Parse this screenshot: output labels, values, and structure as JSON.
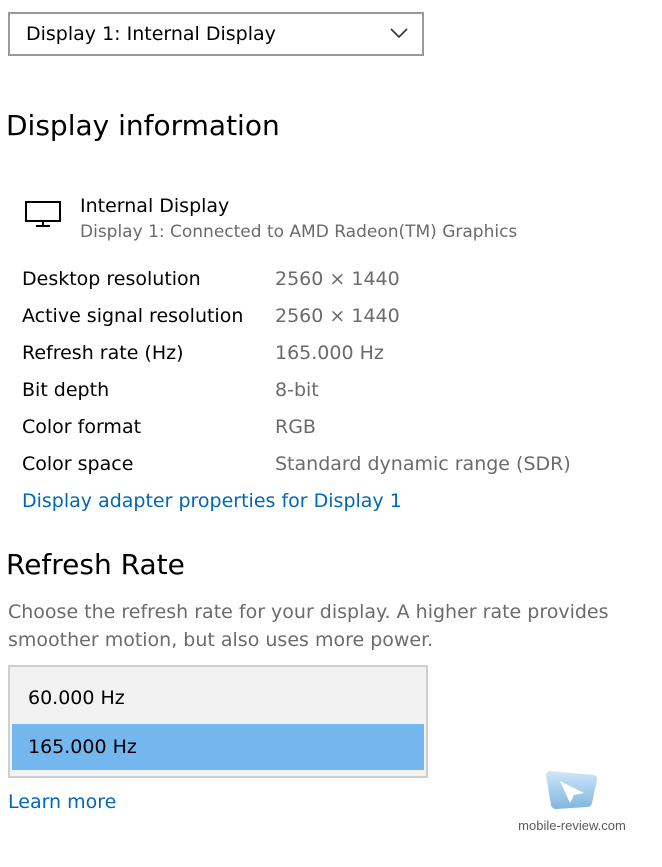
{
  "display_selector": {
    "selected": "Display 1: Internal Display",
    "icon": "chevron-down-icon"
  },
  "display_information": {
    "heading": "Display information",
    "monitor_icon": "monitor-icon",
    "name": "Internal Display",
    "connection": "Display 1: Connected to AMD Radeon(TM) Graphics",
    "rows": [
      {
        "label": "Desktop resolution",
        "value": "2560 × 1440"
      },
      {
        "label": "Active signal resolution",
        "value": "2560 × 1440"
      },
      {
        "label": "Refresh rate (Hz)",
        "value": "165.000 Hz"
      },
      {
        "label": "Bit depth",
        "value": "8-bit"
      },
      {
        "label": "Color format",
        "value": "RGB"
      },
      {
        "label": "Color space",
        "value": "Standard dynamic range (SDR)"
      }
    ],
    "adapter_link": "Display adapter properties for Display 1"
  },
  "refresh_rate": {
    "heading": "Refresh Rate",
    "description": "Choose the refresh rate for your display. A higher rate provides smoother motion, but also uses more power.",
    "options": [
      {
        "label": "60.000 Hz",
        "selected": false
      },
      {
        "label": "165.000 Hz",
        "selected": true
      }
    ],
    "learn_more": "Learn more"
  },
  "watermark": {
    "text": "mobile-review.com"
  },
  "colors": {
    "link": "#0067b8",
    "selected_option": "#73b7ee",
    "secondary_text": "#6b6b6b"
  }
}
